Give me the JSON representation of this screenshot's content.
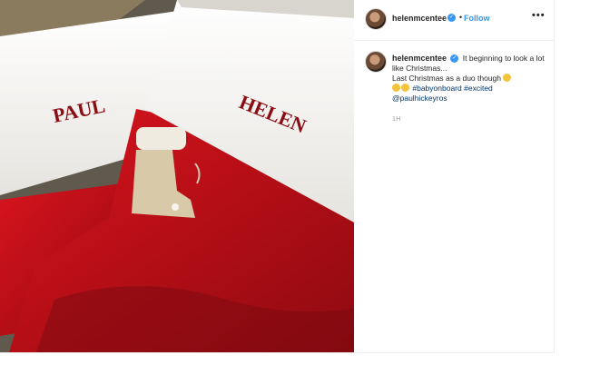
{
  "post": {
    "header": {
      "username": "helenmcentee",
      "verified_mark": "✓",
      "separator": "•",
      "follow_label": "Follow",
      "more_label": "•••"
    },
    "caption": {
      "username": "helenmcentee",
      "verified_mark": "✓",
      "line1": "It beginning to look a lot like Christmas...",
      "line2": "Last Christmas as a duo though",
      "hashtags": [
        "#babyonboard",
        "#excited"
      ],
      "mention": "@paulhickeyros",
      "timestamp": "1h"
    },
    "image": {
      "stocking_left_name": "PAUL",
      "stocking_right_name": "HELEN"
    }
  },
  "colors": {
    "link_blue": "#3897f0",
    "hashtag_blue": "#003569",
    "stocking_red": "#c8101a",
    "name_red": "#8b0d14"
  },
  "icons": [
    "verified-badge-icon",
    "more-options-icon",
    "emoji-icon"
  ]
}
